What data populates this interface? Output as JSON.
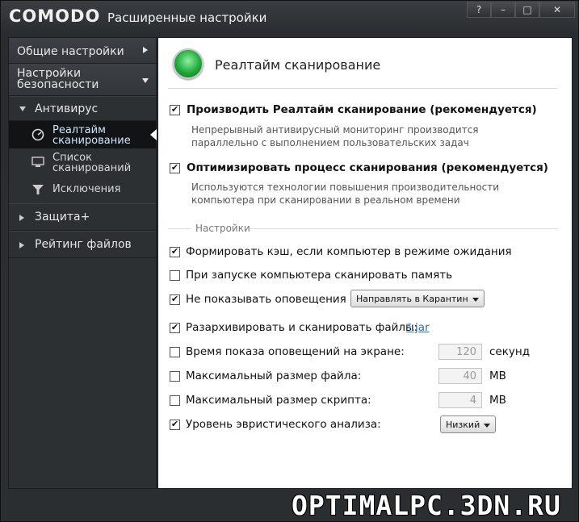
{
  "app": {
    "logo": "COMODO",
    "title": "Расширенные настройки",
    "window_buttons": {
      "help": "?",
      "minimize": "–",
      "maximize": "□",
      "close": "✕"
    }
  },
  "sidebar": {
    "general": "Общие настройки",
    "security": "Настройки безопасности",
    "antivirus": "Антивирус",
    "sub": {
      "realtime": "Реалтайм сканирование",
      "scan_list": "Список сканирований",
      "exclusions": "Исключения"
    },
    "protection": "Защита+",
    "file_rating": "Рейтинг файлов"
  },
  "main": {
    "title": "Реалтайм сканирование",
    "opt1": {
      "label": "Производить Реалтайм сканирование (рекомендуется)",
      "checked": true,
      "desc": "Непрерывный антивирусный мониторинг производится параллельно с выполнением пользовательских задач"
    },
    "opt2": {
      "label": "Оптимизировать процесс сканирования (рекомендуется)",
      "checked": true,
      "desc": "Используются технологии повышения производительности компьютера при сканировании в реальном времени"
    },
    "section": "Настройки",
    "settings": {
      "cache": {
        "label": "Формировать кэш, если компьютер в режиме ожидания",
        "checked": true
      },
      "memory": {
        "label": "При запуске компьютера сканировать память",
        "checked": false
      },
      "alerts": {
        "label": "Не показывать оповещения",
        "checked": true,
        "dropdown": "Направлять в Карантин"
      },
      "unpack": {
        "label": "Разархивировать и сканировать файлы:",
        "checked": true,
        "link": "*.jar"
      },
      "alert_time": {
        "label": "Время показа оповещений на экране:",
        "checked": false,
        "value": "120",
        "unit": "секунд"
      },
      "max_file": {
        "label": "Максимальный размер файла:",
        "checked": false,
        "value": "40",
        "unit": "MB"
      },
      "max_script": {
        "label": "Максимальный размер скрипта:",
        "checked": false,
        "value": "4",
        "unit": "MB"
      },
      "heuristic": {
        "label": "Уровень эвристического анализа:",
        "checked": true,
        "dropdown": "Низкий"
      }
    }
  },
  "watermark": "OPTIMALPC.3DN.RU"
}
